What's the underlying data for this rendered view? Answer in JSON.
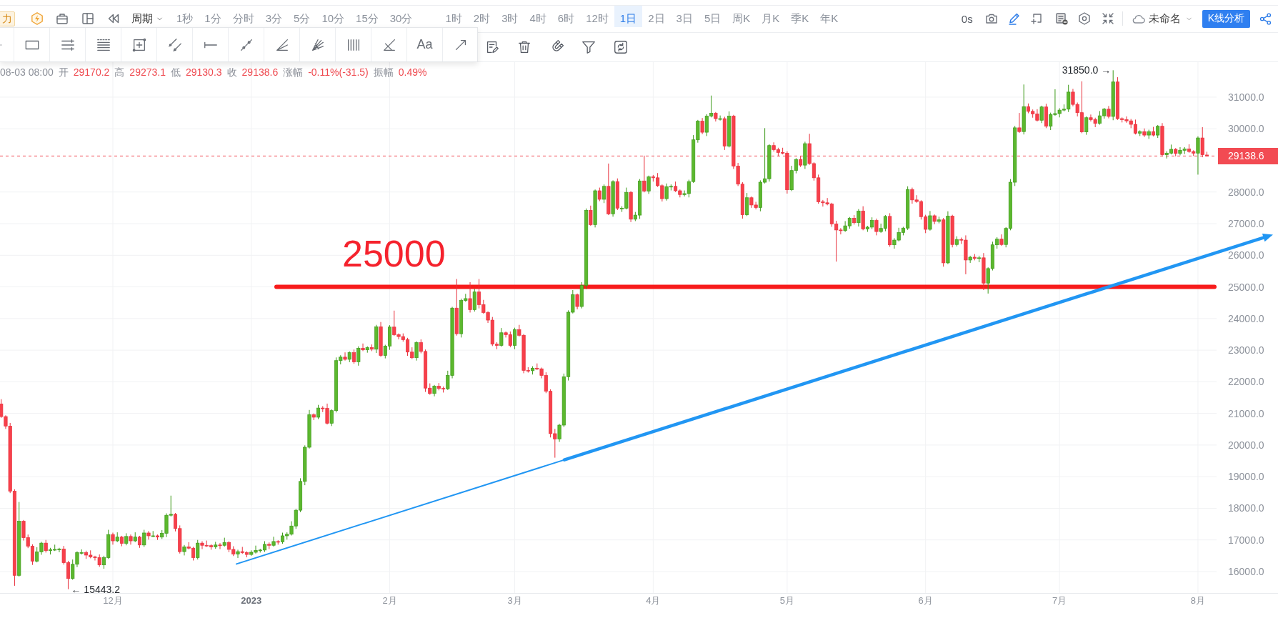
{
  "top_toolbar": {
    "feature_button": "力",
    "period_button": "周期",
    "interval_groups": [
      {
        "items": [
          {
            "label": "1秒",
            "selected": false
          },
          {
            "label": "1分",
            "selected": false
          },
          {
            "label": "分时",
            "selected": false
          },
          {
            "label": "3分",
            "selected": false
          },
          {
            "label": "5分",
            "selected": false
          },
          {
            "label": "10分",
            "selected": false
          },
          {
            "label": "15分",
            "selected": false
          },
          {
            "label": "30分",
            "selected": false
          }
        ]
      },
      {
        "items": [
          {
            "label": "1时",
            "selected": false
          },
          {
            "label": "2时",
            "selected": false
          },
          {
            "label": "3时",
            "selected": false
          },
          {
            "label": "4时",
            "selected": false
          },
          {
            "label": "6时",
            "selected": false
          },
          {
            "label": "12时",
            "selected": false
          },
          {
            "label": "1日",
            "selected": true
          },
          {
            "label": "2日",
            "selected": false
          },
          {
            "label": "3日",
            "selected": false
          },
          {
            "label": "5日",
            "selected": false
          },
          {
            "label": "周K",
            "selected": false
          },
          {
            "label": "月K",
            "selected": false
          },
          {
            "label": "季K",
            "selected": false
          },
          {
            "label": "年K",
            "selected": false
          }
        ]
      }
    ],
    "countdown": "0s",
    "layout_name": "未命名",
    "analysis_button": "K线分析"
  },
  "drawing_tools": {
    "text_tool": "Aa"
  },
  "info_bar": {
    "time": "08-03 08:00",
    "fields": [
      {
        "label": "开",
        "value": "29170.2"
      },
      {
        "label": "高",
        "value": "29273.1"
      },
      {
        "label": "低",
        "value": "29130.3"
      },
      {
        "label": "收",
        "value": "29138.6"
      },
      {
        "label": "涨幅",
        "value": "-0.11%(-31.5)"
      },
      {
        "label": "振幅",
        "value": "0.49%"
      }
    ]
  },
  "chart": {
    "high_label": "31850.0 →",
    "low_label": "← 15443.2",
    "x_label_styles": [
      {
        "bold": false
      },
      {
        "bold": true
      },
      {
        "bold": false
      },
      {
        "bold": false
      },
      {
        "bold": false
      },
      {
        "bold": false
      },
      {
        "bold": false
      },
      {
        "bold": false
      },
      {
        "bold": false
      }
    ],
    "chart_data": {
      "type": "candlestick",
      "ylim": [
        15322,
        32106
      ],
      "grid": true,
      "yticks": [
        {
          "value": 31000,
          "label": "31000.0"
        },
        {
          "value": 30000,
          "label": "30000.0"
        },
        {
          "value": 28000,
          "label": "28000.0"
        },
        {
          "value": 27000,
          "label": "27000.0"
        },
        {
          "value": 26000,
          "label": "26000.0"
        },
        {
          "value": 25000,
          "label": "25000.0"
        },
        {
          "value": 24000,
          "label": "24000.0"
        },
        {
          "value": 23000,
          "label": "23000.0"
        },
        {
          "value": 22000,
          "label": "22000.0"
        },
        {
          "value": 21000,
          "label": "21000.0"
        },
        {
          "value": 20000,
          "label": "20000.0"
        },
        {
          "value": 19000,
          "label": "19000.0"
        },
        {
          "value": 18000,
          "label": "18000.0"
        },
        {
          "value": 17000,
          "label": "17000.0"
        },
        {
          "value": 16000,
          "label": "16000.0"
        }
      ],
      "ref_lines": [
        {
          "axis": "y",
          "value": 25000,
          "label": "25000"
        },
        {
          "axis": "y",
          "value": 29138.6,
          "label": "29138.6"
        }
      ],
      "categories": [
        null,
        null,
        null,
        null,
        null,
        null,
        null,
        null,
        null,
        null,
        null,
        null,
        null,
        null,
        null,
        null,
        null,
        null,
        null,
        null,
        null,
        null,
        null,
        null,
        null,
        "12月",
        null,
        null,
        null,
        null,
        null,
        null,
        null,
        null,
        null,
        null,
        null,
        null,
        null,
        null,
        null,
        null,
        null,
        null,
        null,
        null,
        null,
        null,
        null,
        null,
        null,
        null,
        null,
        null,
        null,
        null,
        "2023",
        null,
        null,
        null,
        null,
        null,
        null,
        null,
        null,
        null,
        null,
        null,
        null,
        null,
        null,
        null,
        null,
        null,
        null,
        null,
        null,
        null,
        null,
        null,
        null,
        null,
        null,
        null,
        null,
        null,
        null,
        "2月",
        null,
        null,
        null,
        null,
        null,
        null,
        null,
        null,
        null,
        null,
        null,
        null,
        null,
        null,
        null,
        null,
        null,
        null,
        null,
        null,
        null,
        null,
        null,
        null,
        null,
        null,
        null,
        "3月",
        null,
        null,
        null,
        null,
        null,
        null,
        null,
        null,
        null,
        null,
        null,
        null,
        null,
        null,
        null,
        null,
        null,
        null,
        null,
        null,
        null,
        null,
        null,
        null,
        null,
        null,
        null,
        null,
        null,
        null,
        "4月",
        null,
        null,
        null,
        null,
        null,
        null,
        null,
        null,
        null,
        null,
        null,
        null,
        null,
        null,
        null,
        null,
        null,
        null,
        null,
        null,
        null,
        null,
        null,
        null,
        null,
        null,
        null,
        null,
        null,
        "5月",
        null,
        null,
        null,
        null,
        null,
        null,
        null,
        null,
        null,
        null,
        null,
        null,
        null,
        null,
        null,
        null,
        null,
        null,
        null,
        null,
        null,
        null,
        null,
        null,
        null,
        null,
        null,
        null,
        null,
        null,
        "6月",
        null,
        null,
        null,
        null,
        null,
        null,
        null,
        null,
        null,
        null,
        null,
        null,
        null,
        null,
        null,
        null,
        null,
        null,
        null,
        null,
        null,
        null,
        null,
        null,
        null,
        null,
        null,
        null,
        null,
        "7月",
        null,
        null,
        null,
        null,
        null,
        null,
        null,
        null,
        null,
        null,
        null,
        null,
        null,
        null,
        null,
        null,
        null,
        null,
        null,
        null,
        null,
        null,
        null,
        null,
        null,
        null,
        null,
        null,
        null,
        null,
        "8月",
        null,
        null
      ],
      "ohlc": [
        [
          21300,
          21450,
          20860,
          20900
        ],
        [
          20900,
          20940,
          20510,
          20600
        ],
        [
          20600,
          20700,
          18480,
          18540
        ],
        [
          18540,
          18600,
          15550,
          15880
        ],
        [
          15880,
          18200,
          15840,
          17590
        ],
        [
          17590,
          17630,
          16980,
          17070
        ],
        [
          17070,
          17170,
          16740,
          16800
        ],
        [
          16800,
          16860,
          16210,
          16330
        ],
        [
          16330,
          16770,
          16290,
          16620
        ],
        [
          16620,
          16940,
          16530,
          16900
        ],
        [
          16900,
          17000,
          16600,
          16660
        ],
        [
          16660,
          16750,
          16540,
          16690
        ],
        [
          16690,
          16850,
          16650,
          16700
        ],
        [
          16700,
          16750,
          16610,
          16710
        ],
        [
          16710,
          16810,
          16220,
          16280
        ],
        [
          16280,
          16340,
          15443.2,
          15780
        ],
        [
          15780,
          16380,
          15740,
          16230
        ],
        [
          16230,
          16640,
          16140,
          16600
        ],
        [
          16600,
          16700,
          16540,
          16600
        ],
        [
          16600,
          16660,
          16400,
          16520
        ],
        [
          16520,
          16670,
          16420,
          16460
        ],
        [
          16460,
          16500,
          16350,
          16440
        ],
        [
          16440,
          16540,
          16150,
          16210
        ],
        [
          16210,
          16500,
          16090,
          16440
        ],
        [
          16440,
          17320,
          16400,
          17170
        ],
        [
          17170,
          17230,
          16850,
          16970
        ],
        [
          16970,
          17240,
          16930,
          17090
        ],
        [
          17090,
          17130,
          16800,
          16890
        ],
        [
          16890,
          17210,
          16830,
          17110
        ],
        [
          17110,
          17170,
          16850,
          16970
        ],
        [
          16970,
          17240,
          16930,
          17090
        ],
        [
          17090,
          17130,
          16750,
          16840
        ],
        [
          16840,
          17320,
          16780,
          17220
        ],
        [
          17220,
          17280,
          17010,
          17130
        ],
        [
          17130,
          17280,
          17090,
          17130
        ],
        [
          17130,
          17170,
          17000,
          17090
        ],
        [
          17090,
          17310,
          17030,
          17210
        ],
        [
          17210,
          17840,
          17090,
          17780
        ],
        [
          17780,
          18400,
          17740,
          17810
        ],
        [
          17810,
          17850,
          17270,
          17360
        ],
        [
          17360,
          17460,
          16570,
          16630
        ],
        [
          16630,
          16840,
          16510,
          16780
        ],
        [
          16780,
          16930,
          16700,
          16740
        ],
        [
          16740,
          16780,
          16350,
          16440
        ],
        [
          16440,
          17000,
          16380,
          16900
        ],
        [
          16900,
          16960,
          16710,
          16830
        ],
        [
          16830,
          16980,
          16780,
          16820
        ],
        [
          16820,
          16860,
          16690,
          16780
        ],
        [
          16780,
          16940,
          16720,
          16840
        ],
        [
          16840,
          16900,
          16710,
          16830
        ],
        [
          16830,
          17070,
          16790,
          16920
        ],
        [
          16920,
          16960,
          16610,
          16700
        ],
        [
          16700,
          16800,
          16490,
          16550
        ],
        [
          16550,
          16690,
          16430,
          16630
        ],
        [
          16630,
          16780,
          16560,
          16600
        ],
        [
          16600,
          16640,
          16450,
          16540
        ],
        [
          16540,
          16670,
          16500,
          16610
        ],
        [
          16610,
          16820,
          16570,
          16670
        ],
        [
          16670,
          16720,
          16600,
          16680
        ],
        [
          16680,
          16960,
          16620,
          16860
        ],
        [
          16860,
          16920,
          16710,
          16830
        ],
        [
          16830,
          17100,
          16790,
          16950
        ],
        [
          16950,
          16990,
          16850,
          16940
        ],
        [
          16940,
          17230,
          16880,
          17130
        ],
        [
          17130,
          17240,
          17010,
          17180
        ],
        [
          17180,
          17590,
          17140,
          17440
        ],
        [
          17440,
          17980,
          17350,
          17940
        ],
        [
          17940,
          18950,
          17880,
          18850
        ],
        [
          18850,
          19990,
          18730,
          19930
        ],
        [
          19930,
          21110,
          19890,
          20960
        ],
        [
          20960,
          21000,
          20790,
          20880
        ],
        [
          20880,
          21270,
          20820,
          21170
        ],
        [
          21170,
          21230,
          21040,
          21160
        ],
        [
          21160,
          21310,
          20650,
          20690
        ],
        [
          20690,
          21130,
          20600,
          21090
        ],
        [
          21090,
          22770,
          21030,
          22670
        ],
        [
          22670,
          22840,
          22550,
          22780
        ],
        [
          22780,
          22930,
          22670,
          22710
        ],
        [
          22710,
          22960,
          22620,
          22920
        ],
        [
          22920,
          23020,
          22570,
          22630
        ],
        [
          22630,
          23120,
          22510,
          23060
        ],
        [
          23060,
          23210,
          22970,
          23010
        ],
        [
          23010,
          23120,
          22920,
          23080
        ],
        [
          23080,
          23180,
          22970,
          23030
        ],
        [
          23030,
          23800,
          22910,
          23740
        ],
        [
          23740,
          23890,
          22790,
          22830
        ],
        [
          22830,
          23170,
          22740,
          23130
        ],
        [
          23130,
          23790,
          23010,
          23730
        ],
        [
          23730,
          24250,
          23450,
          23490
        ],
        [
          23490,
          23530,
          23340,
          23430
        ],
        [
          23430,
          23530,
          23270,
          23330
        ],
        [
          23330,
          23390,
          22820,
          22940
        ],
        [
          22940,
          23090,
          22720,
          22760
        ],
        [
          22760,
          23280,
          22670,
          23240
        ],
        [
          23240,
          23340,
          22900,
          22960
        ],
        [
          22960,
          23020,
          21680,
          21800
        ],
        [
          21800,
          21950,
          21590,
          21630
        ],
        [
          21630,
          21900,
          21540,
          21860
        ],
        [
          21860,
          21960,
          21730,
          21790
        ],
        [
          21790,
          21850,
          21660,
          21780
        ],
        [
          21780,
          22350,
          21740,
          22200
        ],
        [
          22200,
          24370,
          22110,
          24330
        ],
        [
          24330,
          25250,
          23460,
          23520
        ],
        [
          23520,
          24630,
          23400,
          24570
        ],
        [
          24570,
          24780,
          24530,
          24630
        ],
        [
          24630,
          25150,
          24190,
          24280
        ],
        [
          24280,
          24940,
          24220,
          24840
        ],
        [
          24840,
          25250,
          24320,
          24440
        ],
        [
          24440,
          24590,
          24150,
          24190
        ],
        [
          24190,
          24230,
          23860,
          23950
        ],
        [
          23950,
          24050,
          23130,
          23190
        ],
        [
          23190,
          23250,
          23030,
          23150
        ],
        [
          23150,
          23700,
          23110,
          23550
        ],
        [
          23550,
          23590,
          23400,
          23490
        ],
        [
          23490,
          23590,
          23090,
          23150
        ],
        [
          23150,
          23710,
          23030,
          23650
        ],
        [
          23650,
          23800,
          23430,
          23470
        ],
        [
          23470,
          23510,
          22270,
          22360
        ],
        [
          22360,
          22460,
          22290,
          22350
        ],
        [
          22350,
          22490,
          22230,
          22430
        ],
        [
          22430,
          22580,
          22370,
          22410
        ],
        [
          22410,
          22450,
          22110,
          22200
        ],
        [
          22200,
          22300,
          21640,
          21700
        ],
        [
          21700,
          21760,
          20240,
          20360
        ],
        [
          20360,
          20510,
          19600,
          20190
        ],
        [
          20190,
          20670,
          20100,
          20630
        ],
        [
          20630,
          22260,
          20570,
          22160
        ],
        [
          22160,
          24260,
          22040,
          24200
        ],
        [
          24200,
          24900,
          24160,
          24750
        ],
        [
          24750,
          24790,
          24290,
          24380
        ],
        [
          24380,
          25150,
          24320,
          25050
        ],
        [
          25050,
          27480,
          24930,
          27420
        ],
        [
          27420,
          27570,
          26930,
          26970
        ],
        [
          26970,
          28080,
          26880,
          28040
        ],
        [
          28040,
          28140,
          27710,
          27770
        ],
        [
          27770,
          28240,
          27650,
          28180
        ],
        [
          28180,
          28900,
          27270,
          27310
        ],
        [
          27310,
          28370,
          27220,
          28330
        ],
        [
          28330,
          28430,
          27430,
          27490
        ],
        [
          27490,
          27550,
          27370,
          27490
        ],
        [
          27490,
          28140,
          27450,
          27990
        ],
        [
          27990,
          28030,
          27050,
          27140
        ],
        [
          27140,
          27370,
          27080,
          27270
        ],
        [
          27270,
          28410,
          27150,
          28350
        ],
        [
          28350,
          29150,
          27990,
          28030
        ],
        [
          28030,
          28520,
          27940,
          28480
        ],
        [
          28480,
          28540,
          28330,
          28450
        ],
        [
          28450,
          28600,
          28160,
          28200
        ],
        [
          28200,
          28240,
          27700,
          27790
        ],
        [
          27790,
          28270,
          27730,
          28170
        ],
        [
          28170,
          28240,
          28050,
          28180
        ],
        [
          28180,
          28330,
          28000,
          28040
        ],
        [
          28040,
          28080,
          27830,
          27920
        ],
        [
          27920,
          28050,
          27860,
          27950
        ],
        [
          27950,
          28390,
          27830,
          28330
        ],
        [
          28330,
          29800,
          28290,
          29650
        ],
        [
          29650,
          30280,
          29560,
          30240
        ],
        [
          30240,
          30340,
          29830,
          29890
        ],
        [
          29890,
          30460,
          29770,
          30400
        ],
        [
          30400,
          31050,
          30360,
          30490
        ],
        [
          30490,
          30530,
          30230,
          30320
        ],
        [
          30320,
          30420,
          30260,
          30320
        ],
        [
          30320,
          30380,
          29330,
          29450
        ],
        [
          29450,
          30550,
          29410,
          30400
        ],
        [
          30400,
          30440,
          28730,
          28820
        ],
        [
          28820,
          28920,
          28190,
          28250
        ],
        [
          28250,
          28310,
          27160,
          27280
        ],
        [
          27280,
          27970,
          27240,
          27820
        ],
        [
          27820,
          27860,
          27500,
          27590
        ],
        [
          27590,
          27690,
          27450,
          27510
        ],
        [
          27510,
          28370,
          27390,
          28310
        ],
        [
          28310,
          30020,
          28270,
          28420
        ],
        [
          28420,
          29510,
          28330,
          29470
        ],
        [
          29470,
          29570,
          29280,
          29340
        ],
        [
          29340,
          29400,
          29130,
          29250
        ],
        [
          29250,
          29400,
          29190,
          29230
        ],
        [
          29230,
          29290,
          27950,
          28070
        ],
        [
          28070,
          28830,
          28030,
          28680
        ],
        [
          28680,
          29070,
          28590,
          29030
        ],
        [
          29030,
          29130,
          28790,
          28850
        ],
        [
          28850,
          29590,
          28730,
          29530
        ],
        [
          29530,
          29840,
          28860,
          28900
        ],
        [
          28900,
          28940,
          28360,
          28450
        ],
        [
          28450,
          28550,
          27630,
          27690
        ],
        [
          27690,
          27750,
          27540,
          27660
        ],
        [
          27660,
          27810,
          27580,
          27620
        ],
        [
          27620,
          27660,
          26900,
          26990
        ],
        [
          26990,
          27090,
          25800,
          26800
        ],
        [
          26800,
          26860,
          26660,
          26780
        ],
        [
          26780,
          27080,
          26740,
          26930
        ],
        [
          26930,
          27210,
          26840,
          27170
        ],
        [
          27170,
          27270,
          26970,
          27030
        ],
        [
          27030,
          27460,
          26910,
          27400
        ],
        [
          27400,
          27550,
          26790,
          26830
        ],
        [
          26830,
          26930,
          26740,
          26890
        ],
        [
          26890,
          27200,
          26830,
          27100
        ],
        [
          27100,
          27160,
          26630,
          26750
        ],
        [
          26750,
          27000,
          26710,
          26850
        ],
        [
          26850,
          27270,
          26760,
          27230
        ],
        [
          27230,
          27330,
          26270,
          26330
        ],
        [
          26330,
          26540,
          26210,
          26480
        ],
        [
          26480,
          26870,
          26440,
          26720
        ],
        [
          26720,
          26900,
          26630,
          26860
        ],
        [
          26860,
          28180,
          26800,
          28080
        ],
        [
          28080,
          28140,
          27630,
          27750
        ],
        [
          27750,
          27900,
          27660,
          27700
        ],
        [
          27700,
          27740,
          27130,
          27220
        ],
        [
          27220,
          27280,
          26700,
          26820
        ],
        [
          26820,
          27400,
          26780,
          27250
        ],
        [
          27250,
          27290,
          26980,
          27070
        ],
        [
          27070,
          27220,
          27010,
          27120
        ],
        [
          27120,
          27180,
          25640,
          25760
        ],
        [
          25760,
          27390,
          25720,
          27240
        ],
        [
          27240,
          27280,
          26250,
          26340
        ],
        [
          26340,
          26600,
          26280,
          26500
        ],
        [
          26500,
          26560,
          26360,
          26480
        ],
        [
          26480,
          26630,
          25400,
          25850
        ],
        [
          25850,
          25980,
          25760,
          25940
        ],
        [
          25940,
          26040,
          25840,
          25900
        ],
        [
          25900,
          25980,
          25780,
          25920
        ],
        [
          25920,
          26070,
          24900,
          25120
        ],
        [
          25120,
          25620,
          24790,
          25580
        ],
        [
          25580,
          26430,
          25520,
          26330
        ],
        [
          26330,
          26570,
          26210,
          26510
        ],
        [
          26510,
          26660,
          26300,
          26340
        ],
        [
          26340,
          26890,
          26250,
          26850
        ],
        [
          26850,
          28410,
          26790,
          28310
        ],
        [
          28310,
          30090,
          28190,
          30030
        ],
        [
          30030,
          30500,
          29870,
          29910
        ],
        [
          29910,
          31400,
          29820,
          30700
        ],
        [
          30700,
          30800,
          30490,
          30550
        ],
        [
          30550,
          30610,
          30350,
          30470
        ],
        [
          30470,
          30620,
          30230,
          30270
        ],
        [
          30270,
          30730,
          30180,
          30690
        ],
        [
          30690,
          30790,
          30020,
          30080
        ],
        [
          30080,
          30510,
          29960,
          30450
        ],
        [
          30450,
          31250,
          30410,
          30480
        ],
        [
          30480,
          30650,
          30360,
          30590
        ],
        [
          30590,
          30770,
          30550,
          30620
        ],
        [
          30620,
          31390,
          30530,
          31160
        ],
        [
          31160,
          31260,
          30710,
          30770
        ],
        [
          30770,
          30830,
          30390,
          30510
        ],
        [
          30510,
          31500,
          29860,
          29900
        ],
        [
          29900,
          30390,
          29810,
          30350
        ],
        [
          30350,
          30450,
          30230,
          30290
        ],
        [
          30290,
          30350,
          30050,
          30170
        ],
        [
          30170,
          30560,
          30130,
          30410
        ],
        [
          30410,
          30660,
          30320,
          30620
        ],
        [
          30620,
          30720,
          30330,
          30390
        ],
        [
          30390,
          31850,
          30270,
          31480
        ],
        [
          31480,
          31630,
          30280,
          30320
        ],
        [
          30320,
          30360,
          30200,
          30290
        ],
        [
          30290,
          30390,
          30190,
          30250
        ],
        [
          30250,
          30310,
          30020,
          30140
        ],
        [
          30140,
          30290,
          29820,
          29860
        ],
        [
          29860,
          29950,
          29770,
          29910
        ],
        [
          29910,
          30010,
          29740,
          29800
        ],
        [
          29800,
          29970,
          29680,
          29910
        ],
        [
          29910,
          30060,
          29760,
          29800
        ],
        [
          29800,
          30120,
          29710,
          30080
        ],
        [
          30080,
          30180,
          29120,
          29180
        ],
        [
          29180,
          29290,
          29060,
          29230
        ],
        [
          29230,
          29500,
          29190,
          29350
        ],
        [
          29350,
          29390,
          29130,
          29220
        ],
        [
          29220,
          29420,
          29160,
          29320
        ],
        [
          29320,
          29420,
          29200,
          29360
        ],
        [
          29360,
          29510,
          29240,
          29280
        ],
        [
          29280,
          29320,
          29140,
          29230
        ],
        [
          29230,
          29760,
          28550,
          29710
        ],
        [
          29710,
          30050,
          29100,
          29180
        ],
        [
          29170.2,
          29273.1,
          29130.3,
          29138.6
        ]
      ]
    }
  }
}
